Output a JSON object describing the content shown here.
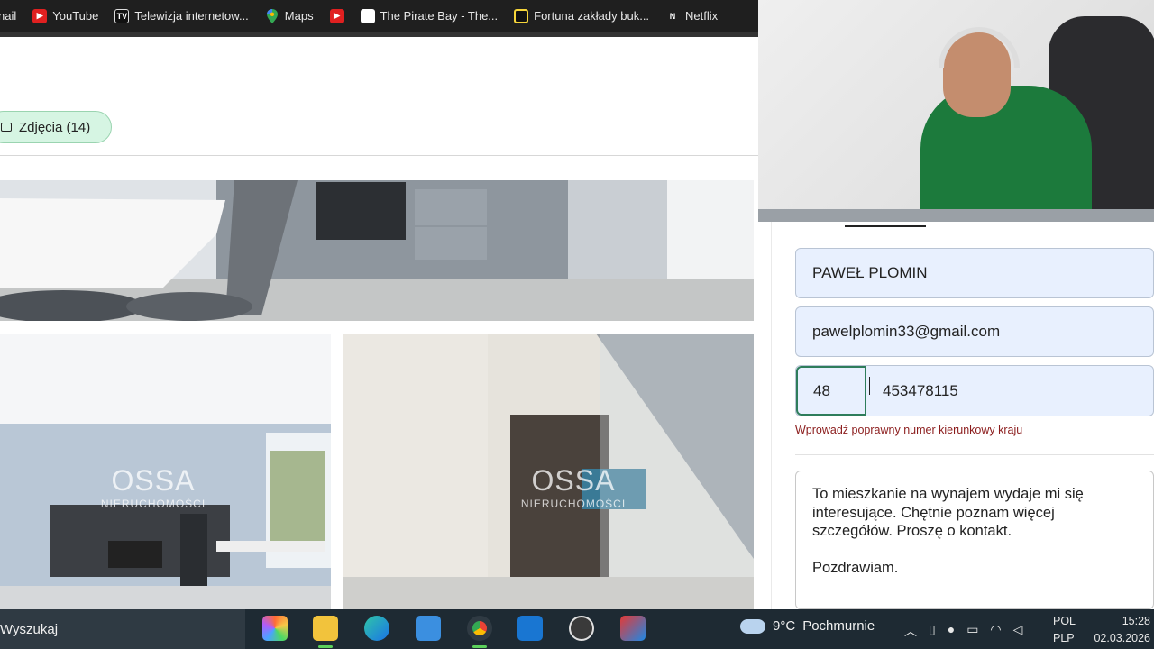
{
  "bookmarks": [
    {
      "label": "nail",
      "icon": "mail-icon"
    },
    {
      "label": "YouTube",
      "icon": "youtube-icon"
    },
    {
      "label": "Telewizja internetow...",
      "icon": "tv-icon"
    },
    {
      "label": "Maps",
      "icon": "maps-pin-icon"
    },
    {
      "label": "",
      "icon": "youtube-icon"
    },
    {
      "label": "The Pirate Bay - The...",
      "icon": "pirate-bay-icon"
    },
    {
      "label": "Fortuna zakłady buk...",
      "icon": "fortuna-icon"
    },
    {
      "label": "Netflix",
      "icon": "netflix-icon"
    }
  ],
  "listing": {
    "photos_button": "Zdjęcia (14)",
    "watermark_brand": "OSSA",
    "watermark_sub": "NIERUCHOMOŚCI"
  },
  "form": {
    "name_value": "PAWEŁ PLOMIN",
    "email_value": "pawelplomin33@gmail.com",
    "phone_prefix": "48",
    "phone_number": "453478115",
    "phone_error": "Wprowadź poprawny numer kierunkowy kraju",
    "message": "To mieszkanie na wynajem wydaje mi się\ninteresujące. Chętnie poznam więcej\nszczegółów. Proszę o kontakt.\n\nPozdrawiam."
  },
  "taskbar": {
    "search_label": "Wyszukaj",
    "weather_temp": "9°C",
    "weather_desc": "Pochmurnie",
    "lang_top": "POL",
    "lang_bottom": "PLP",
    "time": "15:28",
    "date": "02.03.2026"
  },
  "colors": {
    "pill_bg": "#d6f5e3",
    "error_text": "#8b1c1c",
    "autofill_bg": "#e8f0fe",
    "taskbar_bg": "#1e2a33"
  }
}
